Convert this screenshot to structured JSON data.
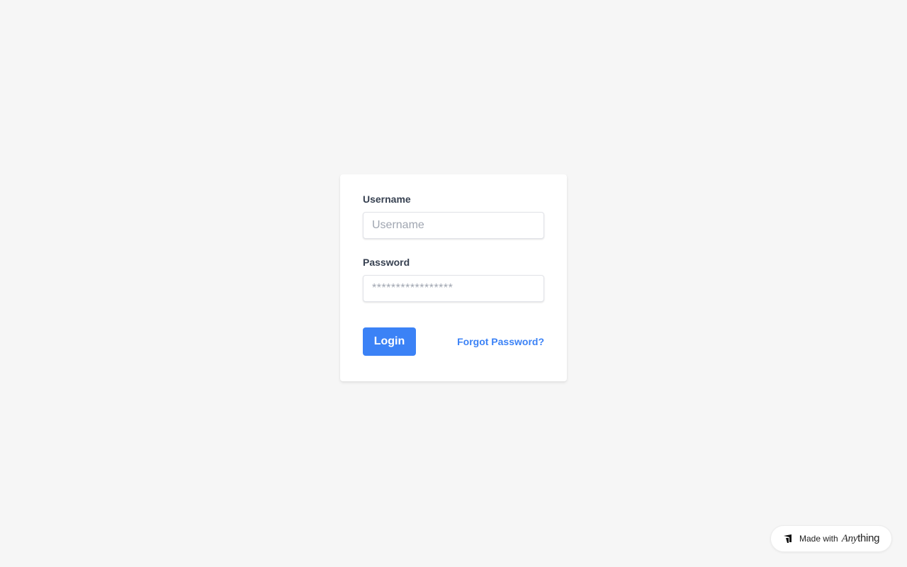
{
  "login_form": {
    "username_label": "Username",
    "username_placeholder": "Username",
    "username_value": "",
    "password_label": "Password",
    "password_placeholder": "*****************",
    "password_value": "",
    "login_button_label": "Login",
    "forgot_password_label": "Forgot Password?"
  },
  "badge": {
    "prefix": "Made with",
    "brand_italic": "Any",
    "brand_rest": "thing",
    "icon": "anything-logo-icon"
  },
  "colors": {
    "background": "#f6f6f6",
    "card": "#ffffff",
    "accent": "#3b82f6",
    "label_text": "#374151"
  }
}
